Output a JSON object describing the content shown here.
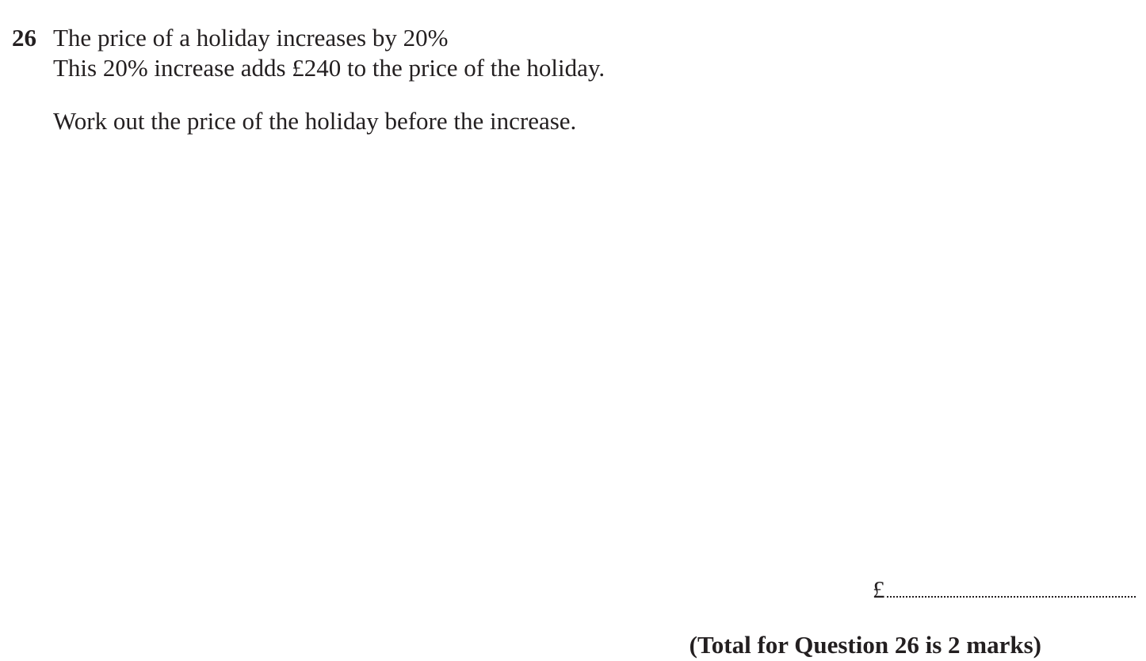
{
  "question": {
    "number": "26",
    "lines": [
      "The price of a holiday increases by 20%",
      "This 20% increase adds £240 to the price of the holiday."
    ],
    "instruction": "Work out the price of the holiday before the increase."
  },
  "answer": {
    "currency_symbol": "£",
    "value": ""
  },
  "total": "(Total for Question 26 is 2 marks)"
}
